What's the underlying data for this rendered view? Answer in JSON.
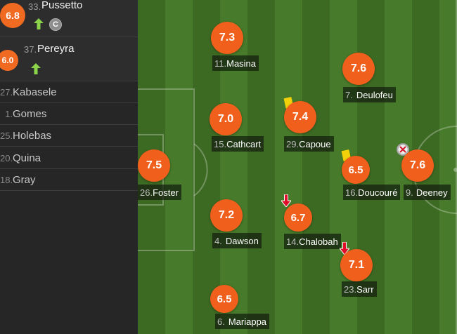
{
  "substitutes": [
    {
      "rating": "6.8",
      "number": "33.",
      "name": "Pussetto",
      "subbed_on": true,
      "captain_badge": "C"
    },
    {
      "rating": "6.0",
      "number": "37.",
      "name": "Pereyra",
      "subbed_on": true
    }
  ],
  "bench": [
    {
      "number": "27.",
      "name": "Kabasele"
    },
    {
      "number": "1.",
      "name": "Gomes"
    },
    {
      "number": "25.",
      "name": "Holebas"
    },
    {
      "number": "20.",
      "name": "Quina"
    },
    {
      "number": "18.",
      "name": "Gray"
    }
  ],
  "players": [
    {
      "rating": "7.3",
      "number": "11.",
      "name": "Masina"
    },
    {
      "rating": "7.6",
      "number": "7.",
      "name": "Deulofeu"
    },
    {
      "rating": "7.0",
      "number": "15.",
      "name": "Cathcart"
    },
    {
      "rating": "7.4",
      "number": "29.",
      "name": "Capoue",
      "yellow_card": true
    },
    {
      "rating": "7.5",
      "number": "26.",
      "name": "Foster"
    },
    {
      "rating": "6.5",
      "number": "16.",
      "name": "Doucouré",
      "yellow_card": true
    },
    {
      "rating": "7.6",
      "number": "9.",
      "name": "Deeney",
      "goal_event": true
    },
    {
      "rating": "7.2",
      "number": "4.",
      "name": "Dawson"
    },
    {
      "rating": "6.7",
      "number": "14.",
      "name": "Chalobah",
      "subbed_off": true
    },
    {
      "rating": "7.1",
      "number": "23.",
      "name": "Sarr",
      "subbed_off": true
    },
    {
      "rating": "6.5",
      "number": "6.",
      "name": "Mariappa"
    }
  ],
  "colors": {
    "rating_circle": "#f0601c",
    "pitch_dark": "#3d6a23",
    "pitch_light": "#477a2a",
    "yellow_card": "#f3d10a",
    "sub_on_arrow": "#8ad34a",
    "sub_off_arrow": "#e0102a"
  },
  "icons": {
    "sub_on": "arrow-up-icon",
    "sub_off": "arrow-down-icon",
    "yellow_card": "yellow-card-icon",
    "goal": "goal-ball-icon",
    "captain": "captain-badge-icon"
  }
}
